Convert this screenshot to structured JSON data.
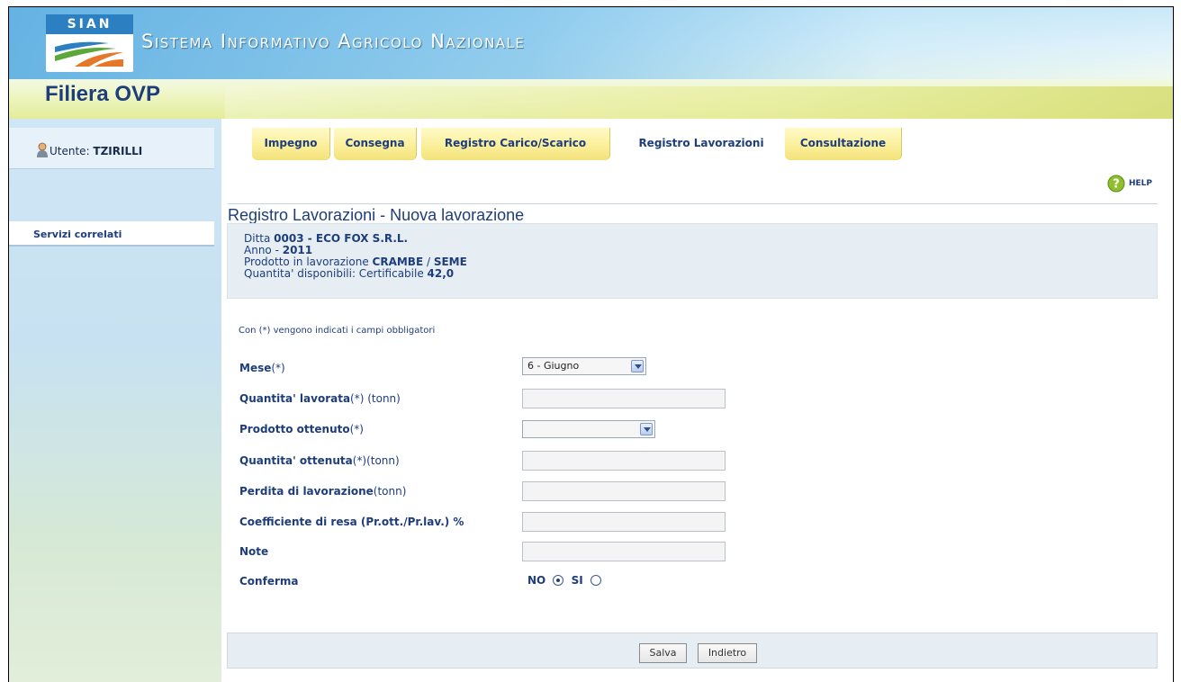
{
  "header": {
    "logo_text": "SIAN",
    "system_title": "Sistema Informativo Agricolo Nazionale",
    "app_title": "Filiera OVP"
  },
  "sidebar": {
    "user_label": "Utente: ",
    "user_name": "TZIRILLI",
    "services_label": "Servizi correlati"
  },
  "tabs": [
    {
      "label": "Impegno"
    },
    {
      "label": "Consegna"
    },
    {
      "label": "Registro Carico/Scarico"
    },
    {
      "label": "Registro Lavorazioni"
    },
    {
      "label": "Consultazione"
    }
  ],
  "page": {
    "title": "Registro Lavorazioni - Nuova lavorazione",
    "help_label": "HELP"
  },
  "info": {
    "ditta_label": "Ditta ",
    "ditta_value": "0003 - ECO FOX S.R.L.",
    "anno_label": "Anno - ",
    "anno_value": "2011",
    "prodotto_label": "Prodotto in lavorazione ",
    "prodotto_value1": "CRAMBE",
    "prodotto_sep": " / ",
    "prodotto_value2": "SEME",
    "quantita_label": "Quantita' disponibili: Certificabile ",
    "quantita_value": "42,0"
  },
  "form": {
    "note_text": "Con (*) vengono indicati i campi obbligatori",
    "mese_label": "Mese",
    "mese_suffix": "(*)",
    "mese_value": "6 - Giugno",
    "qlav_label": "Quantita' lavorata",
    "qlav_suffix": "(*) (tonn)",
    "prod_label": "Prodotto ottenuto",
    "prod_suffix": "(*)",
    "qott_label": "Quantita' ottenuta",
    "qott_suffix": "(*)(tonn)",
    "perdita_label": "Perdita di lavorazione",
    "perdita_suffix": "(tonn)",
    "coeff_label": "Coefficiente di resa (Pr.ott./Pr.lav.) %",
    "note_label": "Note",
    "conferma_label": "Conferma",
    "no_label": "NO",
    "si_label": "SI"
  },
  "buttons": {
    "save": "Salva",
    "back": "Indietro"
  }
}
